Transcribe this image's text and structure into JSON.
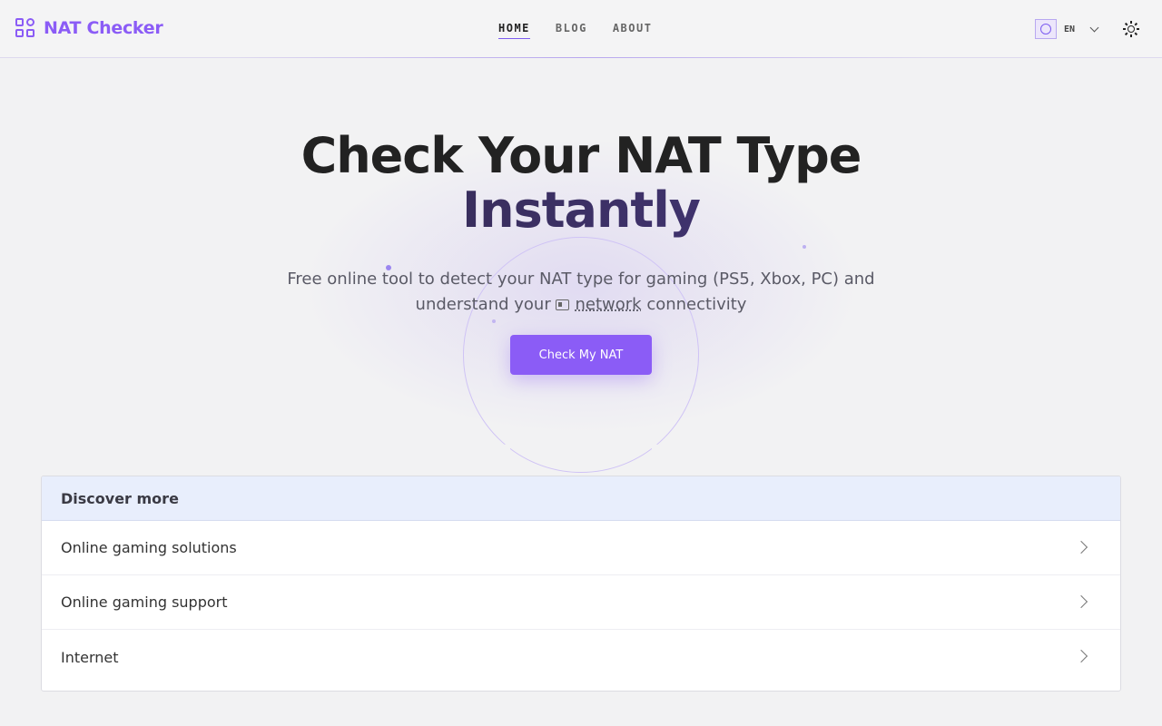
{
  "brand": {
    "name": "NAT Checker",
    "accent": "#8b5cf6"
  },
  "nav": {
    "items": [
      {
        "label": "HOME",
        "active": true
      },
      {
        "label": "BLOG",
        "active": false
      },
      {
        "label": "ABOUT",
        "active": false
      }
    ]
  },
  "lang": {
    "code": "EN",
    "icon": "globe-icon"
  },
  "theme": {
    "icon": "sun-icon"
  },
  "hero": {
    "title_line1": "Check Your NAT Type",
    "title_line2": "Instantly",
    "subtitle_part1": "Free online tool to detect your NAT type for gaming (PS5, Xbox, PC) and understand your",
    "subtitle_link": "network",
    "subtitle_part2": "connectivity",
    "cta_label": "Check My NAT"
  },
  "discover": {
    "title": "Discover more",
    "items": [
      {
        "label": "Online gaming solutions"
      },
      {
        "label": "Online gaming support"
      },
      {
        "label": "Internet"
      }
    ]
  }
}
